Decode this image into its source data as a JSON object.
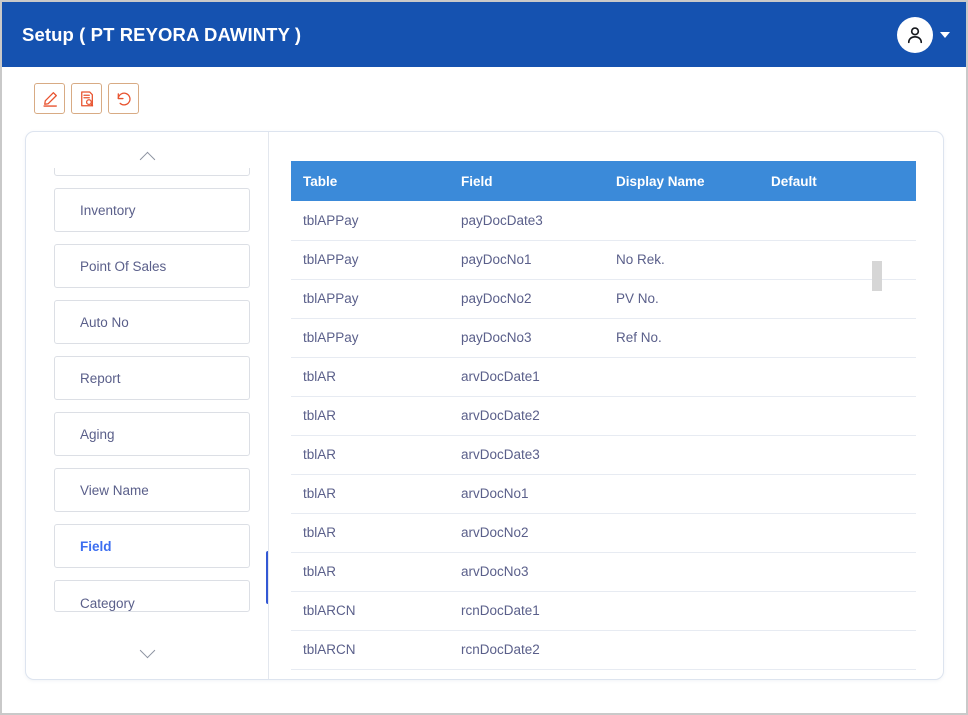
{
  "window": {
    "title": "Setup ( PT REYORA DAWINTY )"
  },
  "header": {
    "avatar_icon": "user-person-icon",
    "caret_icon": "chevron-down-icon"
  },
  "toolbar": {
    "buttons": [
      {
        "name": "edit-button",
        "icon": "pencil-edit-icon",
        "title": "Edit"
      },
      {
        "name": "view-button",
        "icon": "document-search-icon",
        "title": "View"
      },
      {
        "name": "refresh-button",
        "icon": "undo-refresh-icon",
        "title": "Refresh"
      }
    ]
  },
  "sidebar": {
    "scroll_up_icon": "chevron-up-icon",
    "scroll_down_icon": "chevron-down-icon",
    "items": [
      {
        "label": "",
        "active": false,
        "partial": "top"
      },
      {
        "label": "Inventory",
        "active": false,
        "partial": ""
      },
      {
        "label": "Point Of Sales",
        "active": false,
        "partial": ""
      },
      {
        "label": "Auto No",
        "active": false,
        "partial": ""
      },
      {
        "label": "Report",
        "active": false,
        "partial": ""
      },
      {
        "label": "Aging",
        "active": false,
        "partial": ""
      },
      {
        "label": "View Name",
        "active": false,
        "partial": ""
      },
      {
        "label": "Field",
        "active": true,
        "partial": ""
      },
      {
        "label": "Category",
        "active": false,
        "partial": "bottom"
      }
    ]
  },
  "table": {
    "columns": [
      "Table",
      "Field",
      "Display Name",
      "Default"
    ],
    "rows": [
      {
        "table": "tblAPPay",
        "field": "payDocDate3",
        "display_name": "",
        "default": ""
      },
      {
        "table": "tblAPPay",
        "field": "payDocNo1",
        "display_name": "No Rek.",
        "default": ""
      },
      {
        "table": "tblAPPay",
        "field": "payDocNo2",
        "display_name": "PV No.",
        "default": ""
      },
      {
        "table": "tblAPPay",
        "field": "payDocNo3",
        "display_name": "Ref No.",
        "default": ""
      },
      {
        "table": "tblAR",
        "field": "arvDocDate1",
        "display_name": "",
        "default": ""
      },
      {
        "table": "tblAR",
        "field": "arvDocDate2",
        "display_name": "",
        "default": ""
      },
      {
        "table": "tblAR",
        "field": "arvDocDate3",
        "display_name": "",
        "default": ""
      },
      {
        "table": "tblAR",
        "field": "arvDocNo1",
        "display_name": "",
        "default": ""
      },
      {
        "table": "tblAR",
        "field": "arvDocNo2",
        "display_name": "",
        "default": ""
      },
      {
        "table": "tblAR",
        "field": "arvDocNo3",
        "display_name": "",
        "default": ""
      },
      {
        "table": "tblARCN",
        "field": "rcnDocDate1",
        "display_name": "",
        "default": ""
      },
      {
        "table": "tblARCN",
        "field": "rcnDocDate2",
        "display_name": "",
        "default": ""
      }
    ]
  },
  "colors": {
    "titlebar_blue": "#1552b0",
    "table_header_blue": "#3b8ad9",
    "accent_orange": "#e8522e",
    "active_item_blue": "#3c6ef0",
    "text_muted": "#5a5f8a",
    "sidebar_thumb": "#3358d4",
    "table_thumb": "#d6d6d6"
  }
}
